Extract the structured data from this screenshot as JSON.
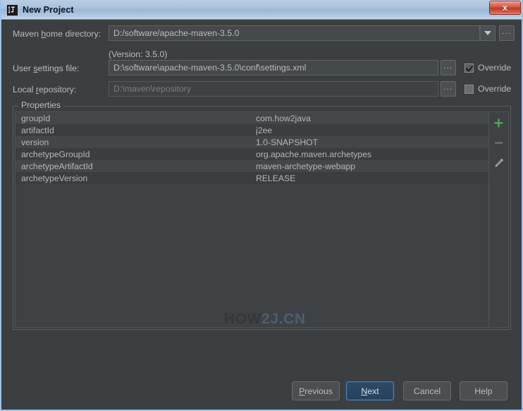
{
  "window": {
    "title": "New Project",
    "app_icon": "intellij-idea-icon",
    "close_label": "x",
    "frame_color": "#9fc3e8",
    "titlebar_gradient_top": "#b9cde2",
    "background": "#3c3f41"
  },
  "form": {
    "maven_home": {
      "label_pre": "Maven ",
      "label_mnemonic": "h",
      "label_post": "ome directory:",
      "value": "D:/software/apache-maven-3.5.0",
      "dropdown_icon": "chevron-down-icon",
      "browse_label": "..."
    },
    "version_note": "(Version: 3.5.0)",
    "user_settings": {
      "label_pre": "User ",
      "label_mnemonic": "s",
      "label_post": "ettings file:",
      "value": "D:\\software\\apache-maven-3.5.0\\conf\\settings.xml",
      "browse_label": "...",
      "override_label": "Override",
      "override_checked": true
    },
    "local_repository": {
      "label_pre": "Local ",
      "label_mnemonic": "r",
      "label_post": "epository:",
      "value": "D:\\maven\\repository",
      "disabled": true,
      "browse_label": "...",
      "override_label": "Override",
      "override_checked": false
    }
  },
  "properties": {
    "legend": "Properties",
    "rows": [
      {
        "key": "groupId",
        "value": "com.how2java"
      },
      {
        "key": "artifactId",
        "value": "j2ee"
      },
      {
        "key": "version",
        "value": "1.0-SNAPSHOT"
      },
      {
        "key": "archetypeGroupId",
        "value": "org.apache.maven.archetypes"
      },
      {
        "key": "archetypeArtifactId",
        "value": "maven-archetype-webapp"
      },
      {
        "key": "archetypeVersion",
        "value": "RELEASE"
      }
    ],
    "toolbar": {
      "add_icon": "plus-icon",
      "add_color": "#4fa84f",
      "remove_icon": "minus-icon",
      "remove_color": "#707476",
      "edit_icon": "pencil-icon",
      "edit_color": "#8c9092"
    }
  },
  "watermark": {
    "part_a": "HOW",
    "part_b": "2J.CN",
    "color_a": "#35383a",
    "color_b": "#4c5e72"
  },
  "buttons": {
    "previous": {
      "pre": "",
      "mnemonic": "P",
      "post": "revious"
    },
    "next": {
      "pre": "",
      "mnemonic": "N",
      "post": "ext",
      "is_default": true
    },
    "cancel": {
      "label": "Cancel"
    },
    "help": {
      "label": "Help"
    }
  }
}
